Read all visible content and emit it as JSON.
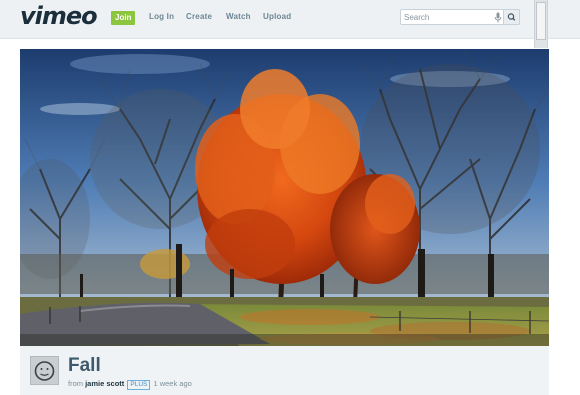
{
  "header": {
    "logo": "vimeo",
    "join_label": "Join",
    "nav": [
      "Log In",
      "Create",
      "Watch",
      "Upload"
    ],
    "search": {
      "placeholder": "Search"
    }
  },
  "video": {
    "title": "Fall",
    "from_label": "from",
    "author": "jamie scott",
    "badge": "PLUS",
    "age": "1 week ago"
  },
  "colors": {
    "header_bg": "#eef1f3",
    "join_green": "#8cc63f",
    "title_blue": "#3d5b6d",
    "plus_blue": "#3d8fc6"
  }
}
